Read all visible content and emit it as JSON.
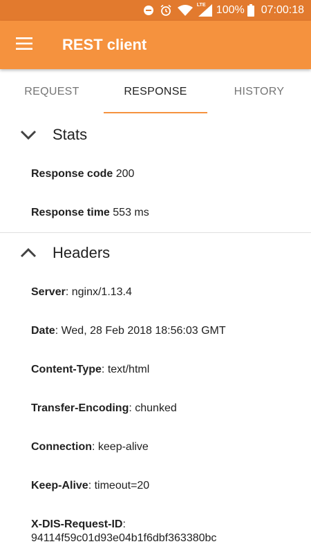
{
  "status_bar": {
    "battery": "100%",
    "time": "07:00:18",
    "network_badge": "LTE",
    "icons": [
      "do-not-disturb-icon",
      "alarm-icon",
      "wifi-icon",
      "cell-signal-icon",
      "battery-icon"
    ]
  },
  "app_bar": {
    "title": "REST client",
    "menu_icon": "hamburger-menu-icon",
    "color": "#f5923e"
  },
  "tabs": [
    {
      "label": "REQUEST",
      "active": false
    },
    {
      "label": "RESPONSE",
      "active": true
    },
    {
      "label": "HISTORY",
      "active": false
    }
  ],
  "stats": {
    "title": "Stats",
    "expanded": true,
    "items": [
      {
        "key": "Response code",
        "sep": " ",
        "value": "200"
      },
      {
        "key": "Response time",
        "sep": " ",
        "value": "553 ms"
      }
    ]
  },
  "headers": {
    "title": "Headers",
    "expanded": true,
    "items": [
      {
        "key": "Server",
        "sep": ": ",
        "value": "nginx/1.13.4"
      },
      {
        "key": "Date",
        "sep": ": ",
        "value": "Wed, 28 Feb 2018 18:56:03 GMT"
      },
      {
        "key": "Content-Type",
        "sep": ": ",
        "value": "text/html"
      },
      {
        "key": "Transfer-Encoding",
        "sep": ": ",
        "value": "chunked"
      },
      {
        "key": "Connection",
        "sep": ": ",
        "value": "keep-alive"
      },
      {
        "key": "Keep-Alive",
        "sep": ": ",
        "value": "timeout=20"
      },
      {
        "key": "X-DIS-Request-ID",
        "sep": ":",
        "value": "94114f59c01d93e04b1f6dbf363380bc"
      }
    ]
  }
}
